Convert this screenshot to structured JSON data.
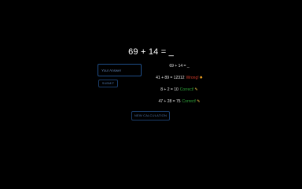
{
  "question": {
    "text": "69 + 14 = _"
  },
  "answer_input": {
    "placeholder": "Your Answer",
    "value": ""
  },
  "submit_button": {
    "label": "SUBMIT"
  },
  "history": [
    {
      "expression": "69 + 14 = _",
      "status": "",
      "status_type": "pending",
      "icon": ""
    },
    {
      "expression": "41 + 89 = 12312",
      "status": "Wrong!",
      "status_type": "wrong",
      "icon": "burst-icon"
    },
    {
      "expression": "8 + 2 = 10",
      "status": "Correct!",
      "status_type": "correct",
      "icon": "party-icon"
    },
    {
      "expression": "47 + 28 = 75",
      "status": "Correct!",
      "status_type": "correct",
      "icon": "party-icon"
    }
  ],
  "new_calculation_button": {
    "label": "NEW CALCULATION"
  },
  "colors": {
    "background": "#000000",
    "text": "#ffffff",
    "accent_blue": "#1f4f8a",
    "wrong": "#d23a2a",
    "correct": "#2fa33a"
  }
}
